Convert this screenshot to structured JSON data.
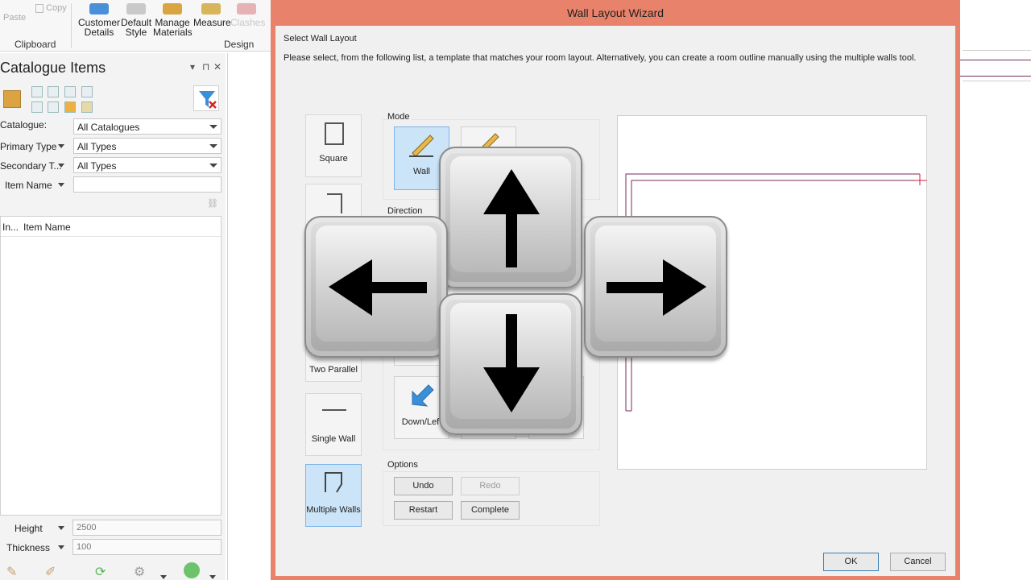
{
  "ribbon": {
    "paste": "Paste",
    "copy": "Copy",
    "customer_details": [
      "Customer",
      "Details"
    ],
    "default_style": [
      "Default",
      "Style"
    ],
    "manage_materials": [
      "Manage",
      "Materials"
    ],
    "measure": "Measure",
    "clashes": "Clashes",
    "groups": {
      "clipboard": "Clipboard",
      "design": "Design"
    }
  },
  "catalogue": {
    "title": "Catalogue Items",
    "filters": [
      {
        "label": "Catalogue:",
        "value": "All Catalogues"
      },
      {
        "label": "Primary Type",
        "value": "All Types"
      },
      {
        "label": "Secondary T...",
        "value": "All Types"
      }
    ],
    "item_name": {
      "label": "Item Name",
      "value": ""
    },
    "columns": [
      "In...",
      "Item Name"
    ],
    "height": {
      "label": "Height",
      "value": "2500"
    },
    "thickness": {
      "label": "Thickness",
      "value": "100"
    }
  },
  "dialog": {
    "title": "Wall Layout Wizard",
    "heading": "Select Wall Layout",
    "description": "Please select, from the following list, a template that matches your room layout. Alternatively, you can create a room outline manually using the multiple walls tool.",
    "templates": [
      {
        "label": "Square",
        "selected": false
      },
      {
        "label": "Two Parallel",
        "selected": false
      },
      {
        "label": "Single Wall",
        "selected": false
      },
      {
        "label": "Multiple Walls",
        "selected": true
      }
    ],
    "mode": {
      "caption": "Mode",
      "wall_label": "Wall"
    },
    "direction": {
      "caption": "Direction",
      "down_left_label": "Down/Left"
    },
    "options": {
      "caption": "Options",
      "undo": "Undo",
      "redo": "Redo",
      "restart": "Restart",
      "complete": "Complete"
    },
    "ok": "OK",
    "cancel": "Cancel"
  },
  "overlay": {
    "keys": [
      "up-arrow",
      "left-arrow",
      "right-arrow",
      "down-arrow"
    ]
  },
  "colors": {
    "dialog_frame": "#e8826a",
    "selection": "#cce4f7",
    "wall_outline": "#7a2a5a"
  }
}
